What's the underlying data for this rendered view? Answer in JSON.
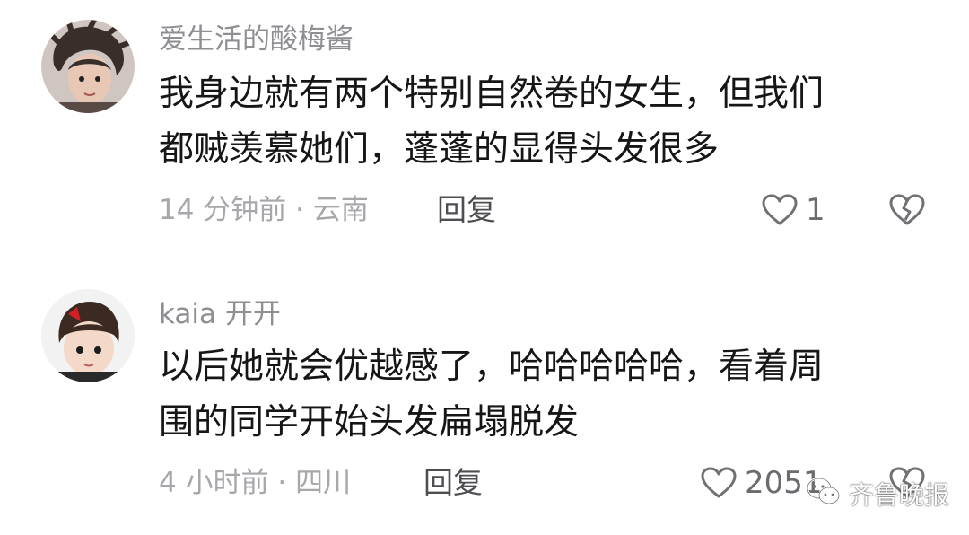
{
  "comments": [
    {
      "username": "爱生活的酸梅酱",
      "text": "我身边就有两个特别自然卷的女生，但我们\n都贼羡慕她们，蓬蓬的显得头发很多",
      "time_location": "14 分钟前 · 云南",
      "reply_label": "回复",
      "likes": "1"
    },
    {
      "username": "kaia 开开",
      "text": "以后她就会优越感了，哈哈哈哈哈，看着周\n围的同学开始头发扁塌脱发",
      "time_location": "4 小时前 · 四川",
      "reply_label": "回复",
      "likes": "2051"
    }
  ],
  "watermark": {
    "text": "齐鲁晚报",
    "icon": "wechat-icon"
  },
  "icons": {
    "like": "heart-outline-icon",
    "dislike": "broken-heart-icon"
  },
  "colors": {
    "username": "#8e8e93",
    "body": "#161616",
    "meta": "#a7a7ab",
    "reply": "#4d4d52"
  }
}
